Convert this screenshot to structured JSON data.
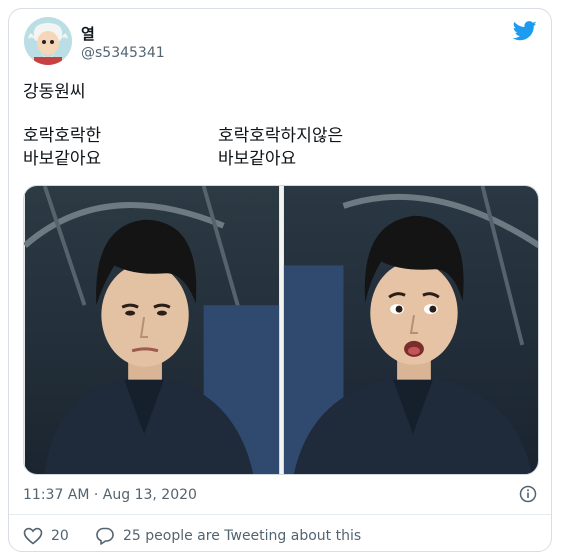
{
  "author": {
    "display_name": "열",
    "handle": "@s5345341",
    "avatar": "cartoon-avatar"
  },
  "brand": {
    "icon": "twitter-bird-icon",
    "color": "#1d9bf0"
  },
  "tweet": {
    "text": "강동원씨",
    "left_caption": [
      "호락호락한",
      "바보같아요"
    ],
    "right_caption": [
      "호락호락하지않은",
      "바보같아요"
    ],
    "timestamp": "11:37 AM · Aug 13, 2020"
  },
  "actions": {
    "like_icon": "heart-icon",
    "like_count": "20",
    "reply_icon": "speech-bubble-icon",
    "reply_text": "25 people are Tweeting about this",
    "info_icon": "info-icon"
  }
}
